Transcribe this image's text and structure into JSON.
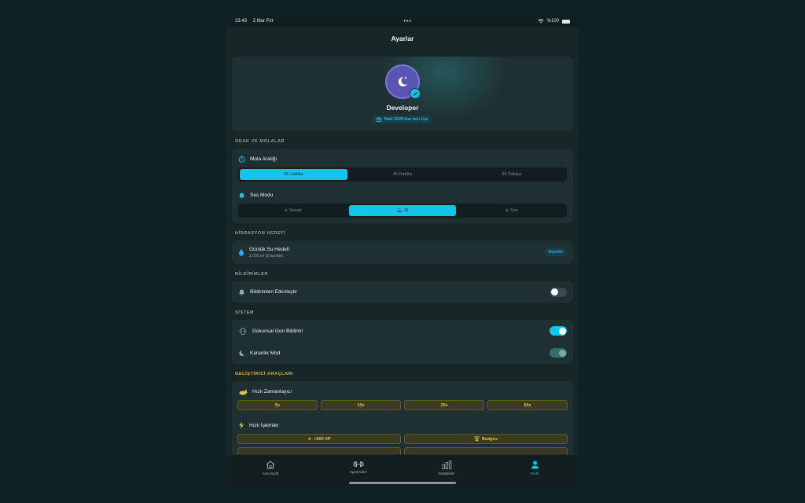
{
  "status": {
    "time": "23:43",
    "date": "2 Mar Pzt",
    "dots": "•••",
    "battery": "%100"
  },
  "nav": {
    "title": "Ayarlar"
  },
  "profile": {
    "name": "Developer",
    "since": "Mart 2026'dan beri üye"
  },
  "sections": {
    "focus": "ODAK VE MOLALAR",
    "hydration": "HİDRASYON HEDEFİ",
    "notifications": "BİLDİRİMLER",
    "system": "SİSTEM",
    "dev": "GELİŞTİRİCİ ARAÇLARI"
  },
  "break": {
    "label": "Mola Aralığı",
    "options": [
      "25 Dakika",
      "45 Dakika",
      "60 Dakika"
    ],
    "selected": "25 Dakika"
  },
  "sound": {
    "label": "Ses Modu",
    "options": [
      "Sessiz",
      "Zil",
      "Ses"
    ],
    "selected": "Zil"
  },
  "water": {
    "label": "Günlük Su Hedefi",
    "sub": "2.000 ml (8 bardak)",
    "button": "Düzenle"
  },
  "notif": {
    "label": "Bildirimleri Etkinleştir",
    "enabled": false
  },
  "system": {
    "haptic": {
      "label": "Dokunsal Geri Bildirim",
      "enabled": true
    },
    "dark": {
      "label": "Karanlık Mod",
      "enabled": true
    }
  },
  "dev": {
    "timer_label": "Hızlı Zamanlayıcı",
    "timer_buttons": [
      "5s",
      "10s",
      "30s",
      "60s"
    ],
    "actions_label": "Hızlı İşlemler",
    "action_buttons": [
      "+500 XP",
      "Badges"
    ]
  },
  "tabs": [
    "Ana Sayfa",
    "Egzersizler",
    "İstatistikler",
    "Profil"
  ],
  "colors": {
    "accent": "#12c5ea",
    "dev": "#e1c23e",
    "bg": "#0f2223"
  }
}
